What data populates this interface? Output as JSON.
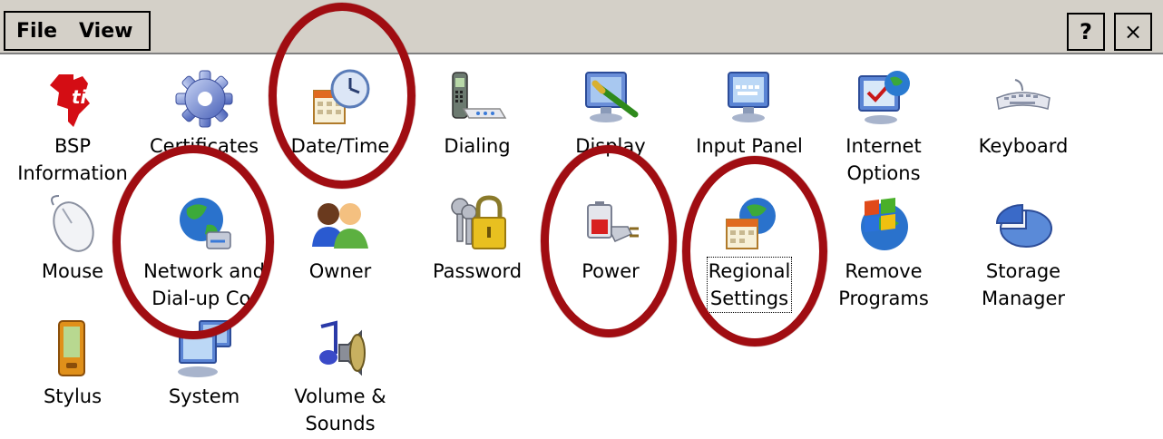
{
  "menu": {
    "file_label": "File",
    "view_label": "View",
    "help_label": "?",
    "close_label": "×"
  },
  "items": [
    {
      "label": "BSP\nInformation",
      "icon": "ti-logo-icon"
    },
    {
      "label": "Certificates",
      "icon": "gear-icon"
    },
    {
      "label": "Date/Time",
      "icon": "clock-calendar-icon"
    },
    {
      "label": "Dialing",
      "icon": "phone-modem-icon"
    },
    {
      "label": "Display",
      "icon": "monitor-brush-icon"
    },
    {
      "label": "Input Panel",
      "icon": "keyboard-monitor-icon"
    },
    {
      "label": "Internet\nOptions",
      "icon": "globe-monitor-icon"
    },
    {
      "label": "Keyboard",
      "icon": "keyboard-icon"
    },
    {
      "label": "Mouse",
      "icon": "mouse-icon"
    },
    {
      "label": "Network and\nDial-up Co.",
      "icon": "network-globe-icon"
    },
    {
      "label": "Owner",
      "icon": "users-icon"
    },
    {
      "label": "Password",
      "icon": "padlock-keys-icon"
    },
    {
      "label": "Power",
      "icon": "battery-plug-icon"
    },
    {
      "label": "Regional\nSettings",
      "icon": "calendar-globe-icon"
    },
    {
      "label": "Remove\nPrograms",
      "icon": "windows-logo-icon"
    },
    {
      "label": "Storage\nManager",
      "icon": "pie-icon"
    },
    {
      "label": "Stylus",
      "icon": "pda-icon"
    },
    {
      "label": "System",
      "icon": "computers-icon"
    },
    {
      "label": "Volume &\nSounds",
      "icon": "speaker-note-icon"
    }
  ],
  "colors": {
    "highlight_ring": "#a00d12",
    "menubar": "#d4d0c8"
  }
}
